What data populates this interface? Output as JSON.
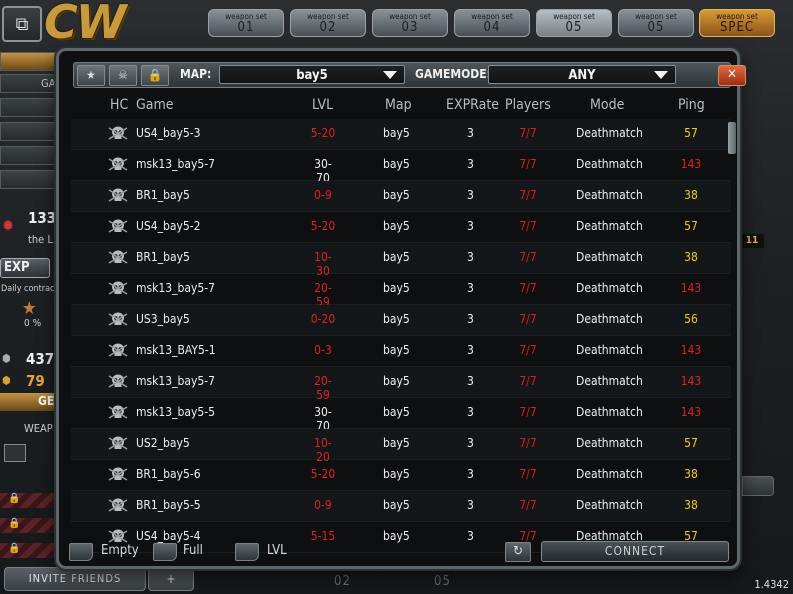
{
  "app": {
    "logo": "CW",
    "version": "1.4342",
    "weapon_sets": [
      {
        "title": "weapon set",
        "num": "01"
      },
      {
        "title": "weapon set",
        "num": "02"
      },
      {
        "title": "weapon set",
        "num": "03"
      },
      {
        "title": "weapon set",
        "num": "04"
      },
      {
        "title": "weapon set",
        "num": "05"
      },
      {
        "title": "weapon set",
        "num": "05"
      },
      {
        "title": "weapon set",
        "num": "SPEC"
      }
    ],
    "sidebar": {
      "ga_label": "GA",
      "points": "133",
      "sub": "the L",
      "exp_label": "EXP",
      "daily": "Daily contrac",
      "percent": "0 %",
      "cp": "437",
      "gp": "79",
      "ge_label": "GE",
      "weap_label": "WEAP"
    },
    "invite_label": "INVITE FRIENDS",
    "invite_icon": "+",
    "bottom_tabs": [
      "02",
      "05"
    ],
    "right_badge": "11"
  },
  "dialog": {
    "filter": {
      "map_label": "MAP:",
      "map_value": "bay5",
      "gamemode_label": "GAMEMODE:",
      "gamemode_value": "ANY",
      "close": "✕"
    },
    "columns": {
      "hc": "HC",
      "game": "Game",
      "lvl": "LVL",
      "map": "Map",
      "exp": "EXPRate",
      "players": "Players",
      "mode": "Mode",
      "ping": "Ping"
    },
    "rows": [
      {
        "game": "US4_bay5-3",
        "lvl": "5-20",
        "lvl_color": "#e41f1f",
        "map": "bay5",
        "exp": "3",
        "players": "7/7",
        "mode": "Deathmatch",
        "ping": "57",
        "ping_color": "#f2d000"
      },
      {
        "game": "msk13_bay5-7",
        "lvl": "30-70",
        "lvl_color": "#efefef",
        "map": "bay5",
        "exp": "3",
        "players": "7/7",
        "mode": "Deathmatch",
        "ping": "143",
        "ping_color": "#e41f1f"
      },
      {
        "game": "BR1_bay5",
        "lvl": "0-9",
        "lvl_color": "#e41f1f",
        "map": "bay5",
        "exp": "3",
        "players": "7/7",
        "mode": "Deathmatch",
        "ping": "38",
        "ping_color": "#f2d000"
      },
      {
        "game": "US4_bay5-2",
        "lvl": "5-20",
        "lvl_color": "#e41f1f",
        "map": "bay5",
        "exp": "3",
        "players": "7/7",
        "mode": "Deathmatch",
        "ping": "57",
        "ping_color": "#f2d000"
      },
      {
        "game": "BR1_bay5",
        "lvl": "10-30",
        "lvl_color": "#e41f1f",
        "map": "bay5",
        "exp": "3",
        "players": "7/7",
        "mode": "Deathmatch",
        "ping": "38",
        "ping_color": "#f2d000"
      },
      {
        "game": "msk13_bay5-7",
        "lvl": "20-59",
        "lvl_color": "#e41f1f",
        "map": "bay5",
        "exp": "3",
        "players": "7/7",
        "mode": "Deathmatch",
        "ping": "143",
        "ping_color": "#e41f1f"
      },
      {
        "game": "US3_bay5",
        "lvl": "0-20",
        "lvl_color": "#e41f1f",
        "map": "bay5",
        "exp": "3",
        "players": "7/7",
        "mode": "Deathmatch",
        "ping": "56",
        "ping_color": "#f2d000"
      },
      {
        "game": "msk13_BAY5-1",
        "lvl": "0-3",
        "lvl_color": "#e41f1f",
        "map": "bay5",
        "exp": "3",
        "players": "7/7",
        "mode": "Deathmatch",
        "ping": "143",
        "ping_color": "#e41f1f"
      },
      {
        "game": "msk13_bay5-7",
        "lvl": "20-59",
        "lvl_color": "#e41f1f",
        "map": "bay5",
        "exp": "3",
        "players": "7/7",
        "mode": "Deathmatch",
        "ping": "143",
        "ping_color": "#e41f1f"
      },
      {
        "game": "msk13_bay5-5",
        "lvl": "30-70",
        "lvl_color": "#efefef",
        "map": "bay5",
        "exp": "3",
        "players": "7/7",
        "mode": "Deathmatch",
        "ping": "143",
        "ping_color": "#e41f1f"
      },
      {
        "game": "US2_bay5",
        "lvl": "10-20",
        "lvl_color": "#e41f1f",
        "map": "bay5",
        "exp": "3",
        "players": "7/7",
        "mode": "Deathmatch",
        "ping": "57",
        "ping_color": "#f2d000"
      },
      {
        "game": "BR1_bay5-6",
        "lvl": "5-20",
        "lvl_color": "#e41f1f",
        "map": "bay5",
        "exp": "3",
        "players": "7/7",
        "mode": "Deathmatch",
        "ping": "38",
        "ping_color": "#f2d000"
      },
      {
        "game": "BR1_bay5-5",
        "lvl": "0-9",
        "lvl_color": "#e41f1f",
        "map": "bay5",
        "exp": "3",
        "players": "7/7",
        "mode": "Deathmatch",
        "ping": "38",
        "ping_color": "#f2d000"
      },
      {
        "game": "US4_bay5-4",
        "lvl": "5-15",
        "lvl_color": "#e41f1f",
        "map": "bay5",
        "exp": "3",
        "players": "7/7",
        "mode": "Deathmatch",
        "ping": "57",
        "ping_color": "#f2d000"
      }
    ],
    "bottom": {
      "empty_label": "Empty",
      "full_label": "Full",
      "lvl_label": "LVL",
      "refresh_icon": "↻",
      "connect_label": "CONNECT"
    }
  }
}
